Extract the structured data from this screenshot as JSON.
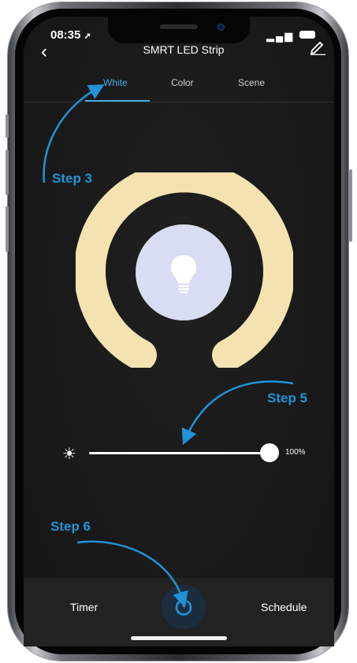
{
  "status_bar": {
    "time": "08:35"
  },
  "header": {
    "title": "SMRT LED Strip",
    "back_icon": "chevron-left-icon",
    "edit_icon": "edit-pencil-icon"
  },
  "tabs": [
    {
      "label": "White",
      "active": true
    },
    {
      "label": "Color",
      "active": false
    },
    {
      "label": "Scene",
      "active": false
    }
  ],
  "annotations": {
    "step3": "Step 3",
    "step5": "Step 5",
    "step6": "Step 6",
    "color": "#1f93d6"
  },
  "temperature_dial": {
    "ring_color": "#f4e3b0",
    "center_color": "#d9ddf3",
    "center_icon": "light-bulb-icon"
  },
  "brightness": {
    "icon": "sun-icon",
    "value_label": "100%",
    "level": 1.0
  },
  "footer": {
    "timer_label": "Timer",
    "schedule_label": "Schedule",
    "power_icon": "power-icon"
  },
  "colors": {
    "accent": "#4aa9e6",
    "background": "#181818"
  }
}
